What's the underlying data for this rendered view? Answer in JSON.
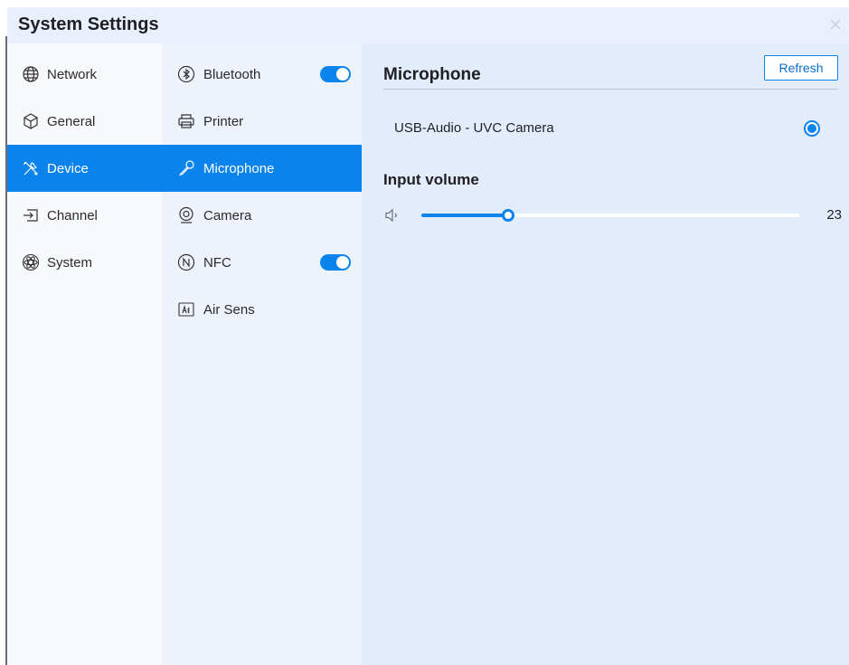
{
  "window": {
    "title": "System Settings"
  },
  "nav": {
    "items": [
      {
        "label": "Network",
        "icon": "globe-icon"
      },
      {
        "label": "General",
        "icon": "cube-icon"
      },
      {
        "label": "Device",
        "icon": "tools-icon",
        "active": true
      },
      {
        "label": "Channel",
        "icon": "input-icon"
      },
      {
        "label": "System",
        "icon": "atom-icon"
      }
    ]
  },
  "subnav": {
    "items": [
      {
        "label": "Bluetooth",
        "icon": "bluetooth-icon",
        "toggle": true
      },
      {
        "label": "Printer",
        "icon": "printer-icon"
      },
      {
        "label": "Microphone",
        "icon": "microphone-icon",
        "active": true
      },
      {
        "label": "Camera",
        "icon": "camera-icon"
      },
      {
        "label": "NFC",
        "icon": "nfc-icon",
        "toggle": true
      },
      {
        "label": "Air Sens",
        "icon": "air-sensor-icon"
      }
    ]
  },
  "panel": {
    "title": "Microphone",
    "refresh_label": "Refresh",
    "device": {
      "name": "USB-Audio - UVC Camera",
      "selected": true
    },
    "volume": {
      "label": "Input volume",
      "value": "23",
      "fraction": 0.23
    }
  },
  "colors": {
    "accent": "#0a84ec",
    "panel_bg": "#e3ecfa",
    "title_bar": "#eaf0fb"
  }
}
